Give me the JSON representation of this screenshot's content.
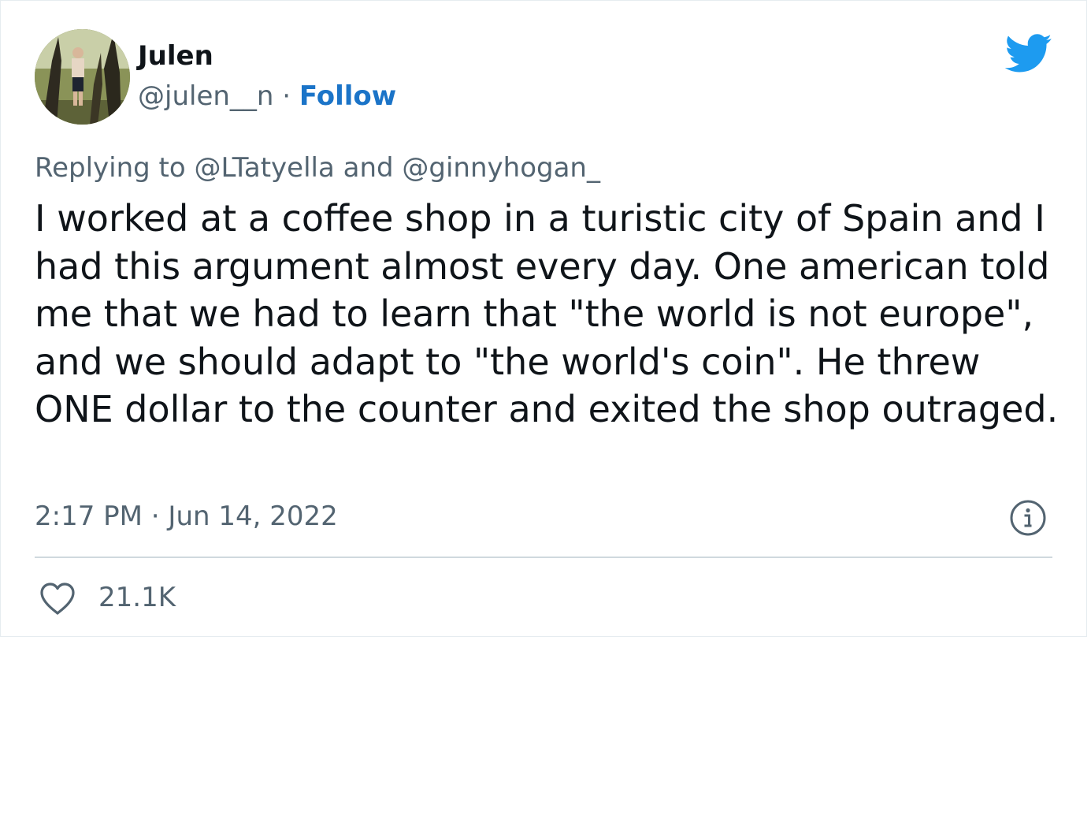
{
  "tweet": {
    "author": {
      "display_name": "Julen",
      "handle": "@julen__n",
      "separator": " · ",
      "follow_label": "Follow"
    },
    "replying_to": "Replying to @LTatyella and @ginnyhogan_",
    "text": "I worked at a coffee shop in a turistic city of Spain and I had this argument almost every day. One american told me that we had to learn that \"the world is not europe\", and we should adapt to \"the world's coin\". He threw ONE dollar to the counter and exited the shop outraged.",
    "timestamp": "2:17 PM · Jun 14, 2022",
    "likes": "21.1K"
  },
  "icons": {
    "logo": "twitter-bird-icon",
    "info": "info-icon",
    "like": "heart-icon"
  },
  "colors": {
    "brand": "#1d9bf0",
    "follow": "#1b74c8",
    "secondary_text": "#536471",
    "divider": "#cfd9de"
  }
}
